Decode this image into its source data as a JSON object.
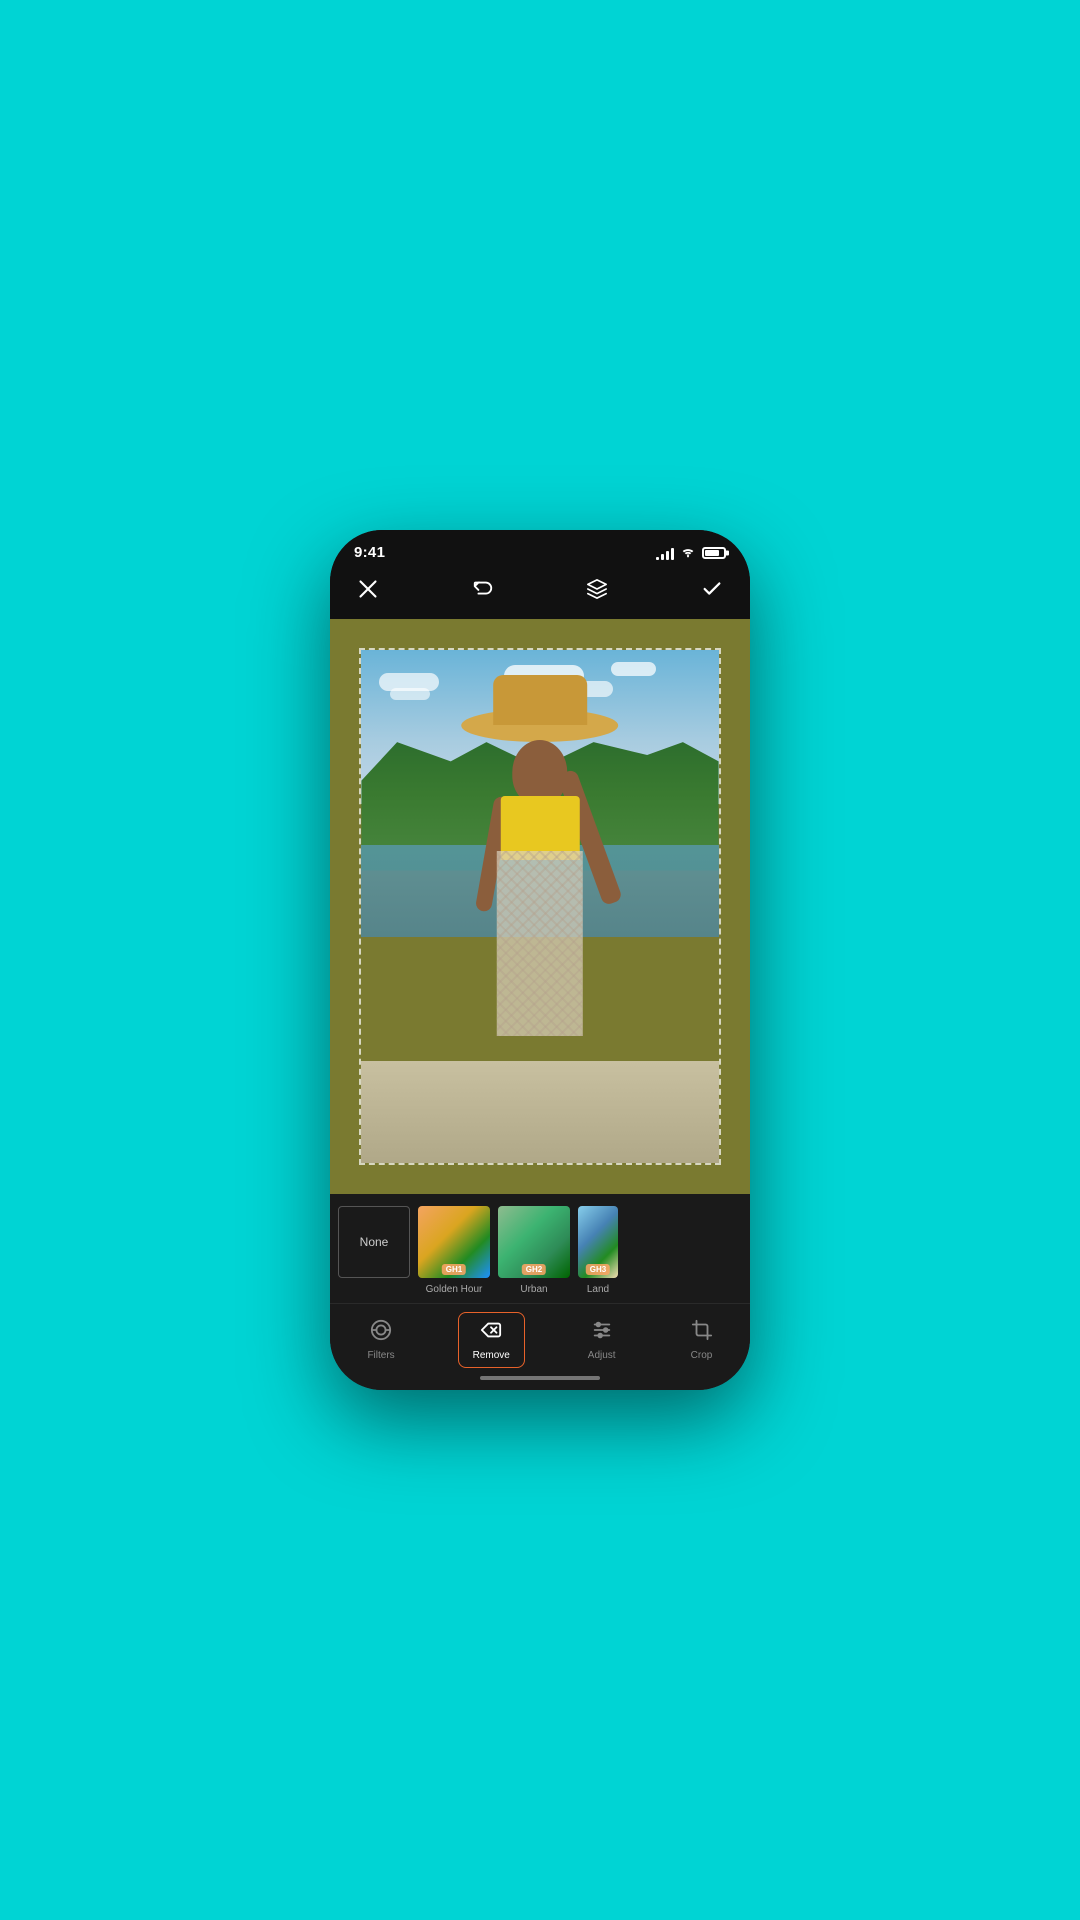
{
  "status": {
    "time": "9:41",
    "signal_bars": [
      3,
      6,
      9,
      12,
      14
    ],
    "battery_pct": 80
  },
  "toolbar": {
    "close_label": "✕",
    "undo_label": "↩",
    "layers_label": "layers",
    "check_label": "✓"
  },
  "filters": {
    "none_label": "None",
    "items": [
      {
        "id": "gh1",
        "badge": "GH1",
        "label": "Golden Hour"
      },
      {
        "id": "gh2",
        "badge": "GH2",
        "label": "Urban"
      },
      {
        "id": "gh3",
        "badge": "GH3",
        "label": "Land"
      }
    ]
  },
  "tabs": [
    {
      "id": "filters",
      "label": "Filters",
      "icon": "filter",
      "active": false
    },
    {
      "id": "remove",
      "label": "Remove",
      "icon": "eraser",
      "active": true
    },
    {
      "id": "adjust",
      "label": "Adjust",
      "icon": "sliders",
      "active": false
    },
    {
      "id": "crop",
      "label": "Crop",
      "icon": "crop",
      "active": false
    }
  ],
  "colors": {
    "background": "#00d4d4",
    "phone_bg": "#1a1a1a",
    "canvas_bg": "#7a7a30",
    "active_tab_border": "#e8622a",
    "accent": "#e8622a"
  }
}
